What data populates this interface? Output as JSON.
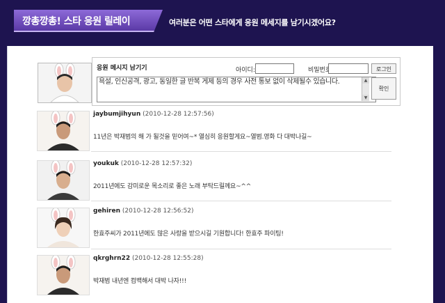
{
  "header": {
    "title": "깡총깡총! 스타 응원 릴레이",
    "subtitle": "여러분은 어떤 스타에게 응원 메세지를 남기시겠어요?"
  },
  "compose": {
    "label": "응원 메시지 남기기",
    "id_label": "아이디:",
    "pw_label": "비밀번호:",
    "login_button": "로그인",
    "message_text": "욕설, 인신공격, 광고, 동일한 글 반복 게제 등의 경우 사전 통보 없이 삭제될수 있습니다.",
    "confirm_button": "확인"
  },
  "entries": [
    {
      "user": "jaybumjihyun",
      "date": "(2010-12-28 12:57:56)",
      "message": "11년은 박재범의 해 가 될것을 믿어여~* 열심히 응원할게요~열범.영화 다 대박나길~"
    },
    {
      "user": "youkuk",
      "date": "(2010-12-28 12:57:32)",
      "message": "2011년에도 감미로운 목소리로 좋은 노래 부탁드릴께요~^^"
    },
    {
      "user": "gehiren",
      "date": "(2010-12-28 12:56:52)",
      "message": "한효주씨가 2011년에도 많은 사랑을 받으시길 기원합니다! 한효주 파이팅!"
    },
    {
      "user": "qkrghrn22",
      "date": "(2010-12-28 12:55:28)",
      "message": "박재범 내년엔 컴백해서 대박 나자!!!"
    }
  ]
}
